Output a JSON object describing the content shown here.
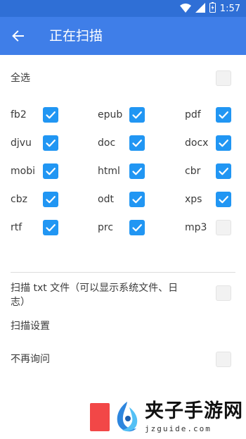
{
  "status_bar": {
    "time": "1:57",
    "icons": [
      "wifi-icon",
      "signal-icon",
      "battery-icon"
    ]
  },
  "app_bar": {
    "title": "正在扫描",
    "back_icon": "arrow-back-icon"
  },
  "select_all": {
    "label": "全选",
    "checked": false
  },
  "formats": [
    {
      "label": "fb2",
      "checked": true
    },
    {
      "label": "epub",
      "checked": true
    },
    {
      "label": "pdf",
      "checked": true
    },
    {
      "label": "djvu",
      "checked": true
    },
    {
      "label": "doc",
      "checked": true
    },
    {
      "label": "docx",
      "checked": true
    },
    {
      "label": "mobi",
      "checked": true
    },
    {
      "label": "html",
      "checked": true
    },
    {
      "label": "cbr",
      "checked": true
    },
    {
      "label": "cbz",
      "checked": true
    },
    {
      "label": "odt",
      "checked": true
    },
    {
      "label": "xps",
      "checked": true
    },
    {
      "label": "rtf",
      "checked": true
    },
    {
      "label": "prc",
      "checked": true
    },
    {
      "label": "mp3",
      "checked": false
    }
  ],
  "scan_txt": {
    "label_line1": "扫描 txt 文件（可以显示系统文件、日",
    "label_line2": "志）",
    "checked": false
  },
  "scan_settings": {
    "label": "扫描设置"
  },
  "no_ask": {
    "label": "不再询问",
    "checked": false
  },
  "watermark": {
    "name": "夹子手游网",
    "url": "jzguide.com"
  },
  "colors": {
    "app_bar": "#3f7ee8",
    "status_bar": "#2f6fd6",
    "checkbox_on": "#2196f3",
    "start_button": "#f24747"
  }
}
